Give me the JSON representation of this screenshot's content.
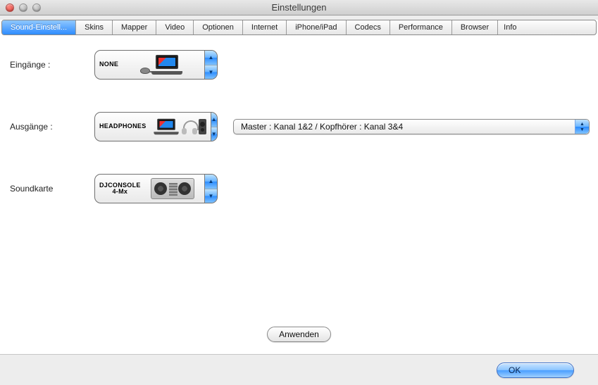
{
  "window": {
    "title": "Einstellungen"
  },
  "tabs": [
    {
      "label": "Sound-Einstell...",
      "active": true
    },
    {
      "label": "Skins"
    },
    {
      "label": "Mapper"
    },
    {
      "label": "Video"
    },
    {
      "label": "Optionen"
    },
    {
      "label": "Internet"
    },
    {
      "label": "iPhone/iPad"
    },
    {
      "label": "Codecs"
    },
    {
      "label": "Performance"
    },
    {
      "label": "Browser"
    },
    {
      "label": "Info"
    }
  ],
  "rows": {
    "inputs": {
      "label": "Eingänge :",
      "device_text_1": "NONE",
      "device_text_2": ""
    },
    "outputs": {
      "label": "Ausgänge :",
      "device_text_1": "HEADPHONES",
      "device_text_2": "",
      "channel_select": "Master : Kanal 1&2 / Kopfhörer : Kanal 3&4"
    },
    "soundcard": {
      "label": "Soundkarte",
      "device_text_1": "DJCONSOLE",
      "device_text_2": "4-Mx"
    }
  },
  "buttons": {
    "apply": "Anwenden",
    "ok": "OK"
  }
}
